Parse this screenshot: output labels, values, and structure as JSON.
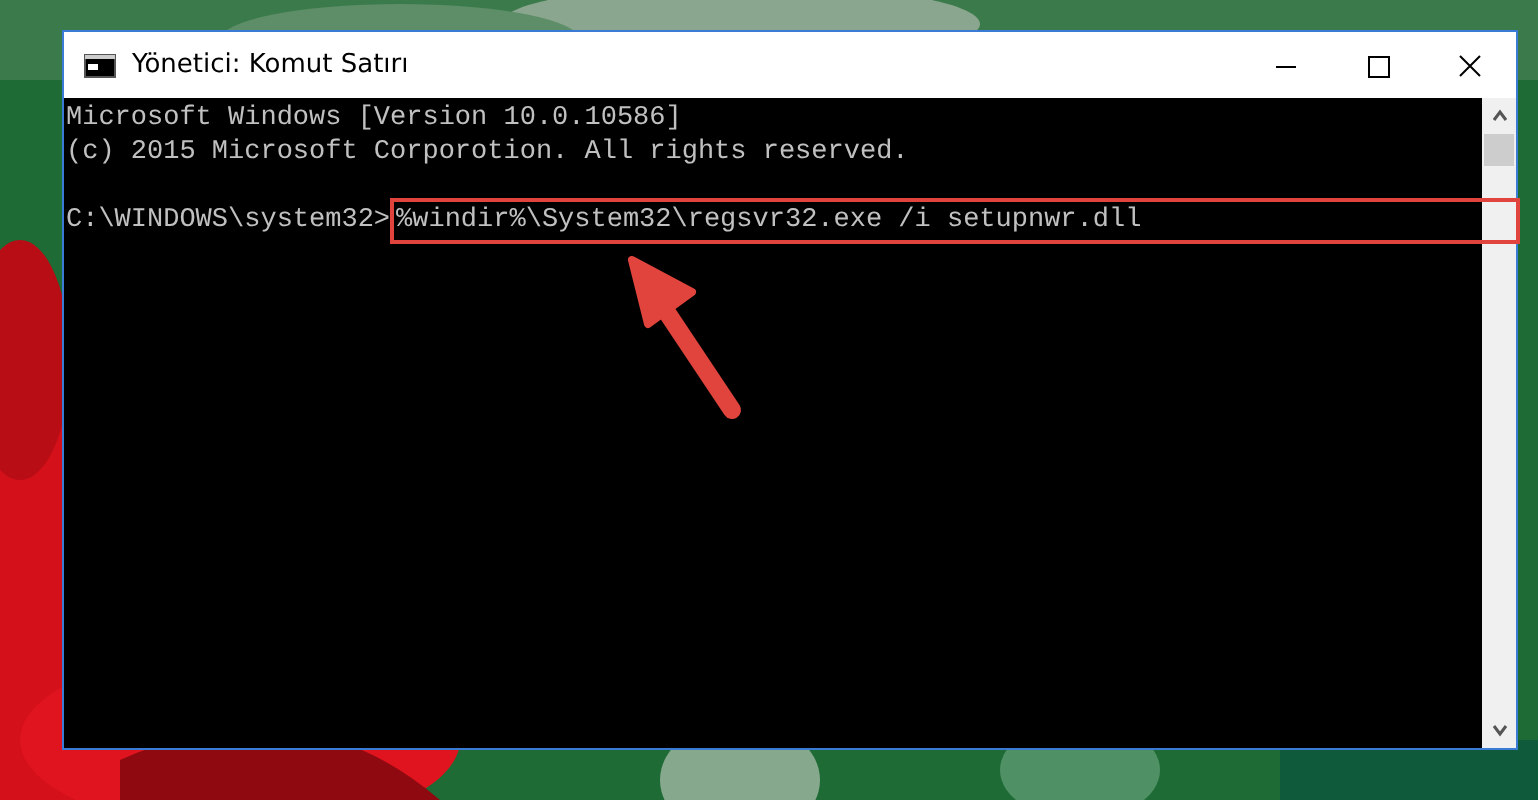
{
  "window": {
    "title": "Yönetici: Komut Satırı"
  },
  "console": {
    "lines": [
      "Microsoft Windows [Version 10.0.10586]",
      "(c) 2015 Microsoft Corporotion. All rights reserved."
    ],
    "prompt": "C:\\WINDOWS\\system32>",
    "command": "%windir%\\System32\\regsvr32.exe /i setupnwr.dll",
    "command_highlighted": true
  },
  "annotations": [
    {
      "kind": "arrow"
    }
  ]
}
